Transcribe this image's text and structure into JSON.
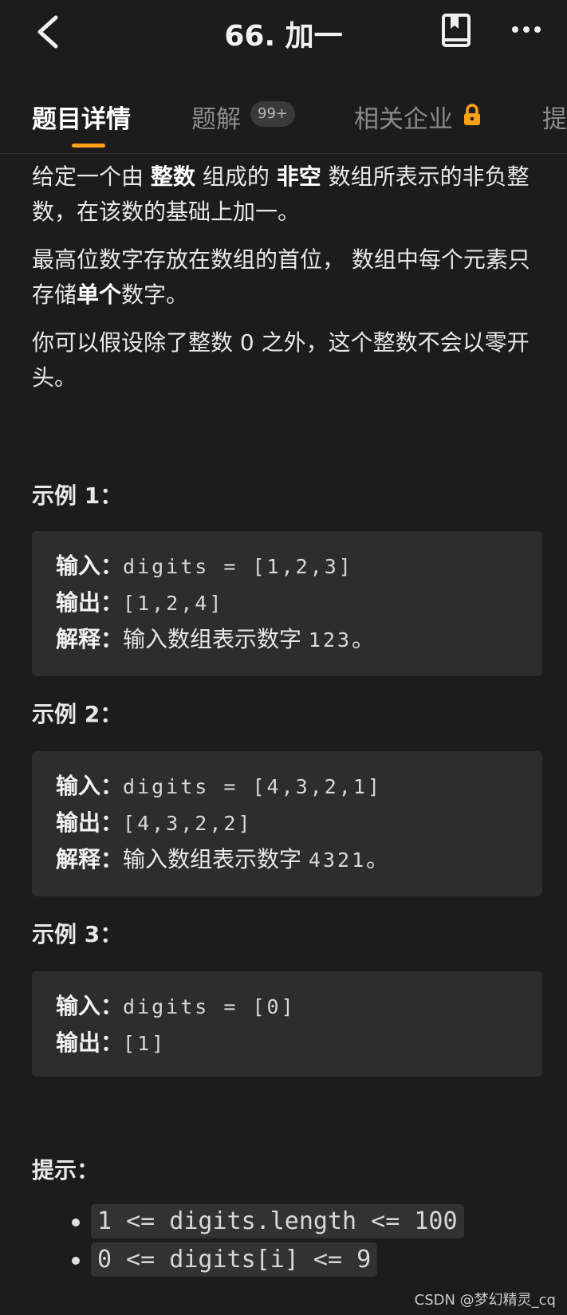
{
  "header": {
    "title": "66. 加一"
  },
  "tabs": [
    {
      "label": "题目详情",
      "active": true
    },
    {
      "label": "题解",
      "badge": "99+"
    },
    {
      "label": "相关企业",
      "locked": true
    },
    {
      "label": "提"
    }
  ],
  "description": {
    "p1_pre": "给定一个由 ",
    "p1_b1": "整数",
    "p1_mid": " 组成的 ",
    "p1_b2": "非空",
    "p1_post": " 数组所表示的非负整数，在该数的基础上加一。",
    "p2_pre": "最高位数字存放在数组的首位， 数组中每个元素只存储",
    "p2_b": "单个",
    "p2_post": "数字。",
    "p3": "你可以假设除了整数 0 之外，这个整数不会以零开头。"
  },
  "examples": [
    {
      "title": "示例 1：",
      "input_label": "输入：",
      "input": "digits = [1,2,3]",
      "output_label": "输出：",
      "output": "[1,2,4]",
      "explain_label": "解释：",
      "explain_text": "输入数组表示数字 ",
      "explain_num": "123",
      "explain_end": "。"
    },
    {
      "title": "示例 2：",
      "input_label": "输入：",
      "input": "digits = [4,3,2,1]",
      "output_label": "输出：",
      "output": "[4,3,2,2]",
      "explain_label": "解释：",
      "explain_text": "输入数组表示数字 ",
      "explain_num": "4321",
      "explain_end": "。"
    },
    {
      "title": "示例 3：",
      "input_label": "输入：",
      "input": "digits = [0]",
      "output_label": "输出：",
      "output": "[1]"
    }
  ],
  "hints": {
    "title": "提示：",
    "items": [
      "1 <= digits.length <= 100",
      "0 <= digits[i] <= 9"
    ]
  },
  "watermark": "CSDN @梦幻精灵_cq",
  "colors": {
    "background": "#1c1c1c",
    "accent": "#ffa116",
    "code_box": "#2d2d2d"
  }
}
